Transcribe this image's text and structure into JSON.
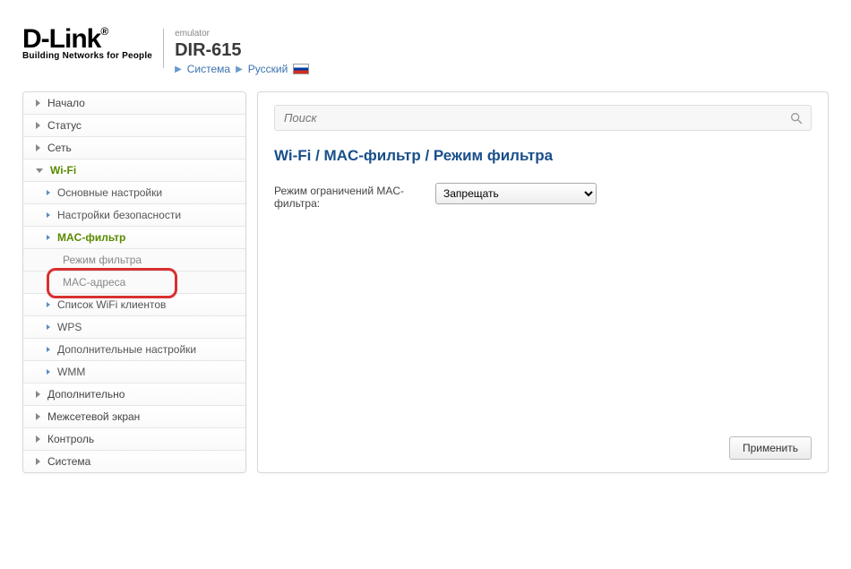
{
  "header": {
    "brand": "D-Link",
    "tagline": "Building Networks for People",
    "emulator": "emulator",
    "model": "DIR-615",
    "system": "Система",
    "language": "Русский"
  },
  "sidebar": {
    "top": [
      {
        "label": "Начало"
      },
      {
        "label": "Статус"
      },
      {
        "label": "Сеть"
      }
    ],
    "wifi": {
      "label": "Wi-Fi",
      "items": [
        {
          "label": "Основные настройки"
        },
        {
          "label": "Настройки безопасности"
        }
      ],
      "macfilter": {
        "label": "MAC-фильтр",
        "sub": [
          {
            "label": "Режим фильтра"
          },
          {
            "label": "MAC-адреса"
          }
        ]
      },
      "items2": [
        {
          "label": "Список WiFi клиентов"
        },
        {
          "label": "WPS"
        },
        {
          "label": "Дополнительные настройки"
        },
        {
          "label": "WMM"
        }
      ]
    },
    "bottom": [
      {
        "label": "Дополнительно"
      },
      {
        "label": "Межсетевой экран"
      },
      {
        "label": "Контроль"
      },
      {
        "label": "Система"
      }
    ]
  },
  "main": {
    "search_placeholder": "Поиск",
    "breadcrumb": "Wi-Fi /  MAC-фильтр /  Режим фильтра",
    "filter_mode_label": "Режим ограничений MAC-фильтра:",
    "filter_mode_value": "Запрещать",
    "apply": "Применить"
  }
}
